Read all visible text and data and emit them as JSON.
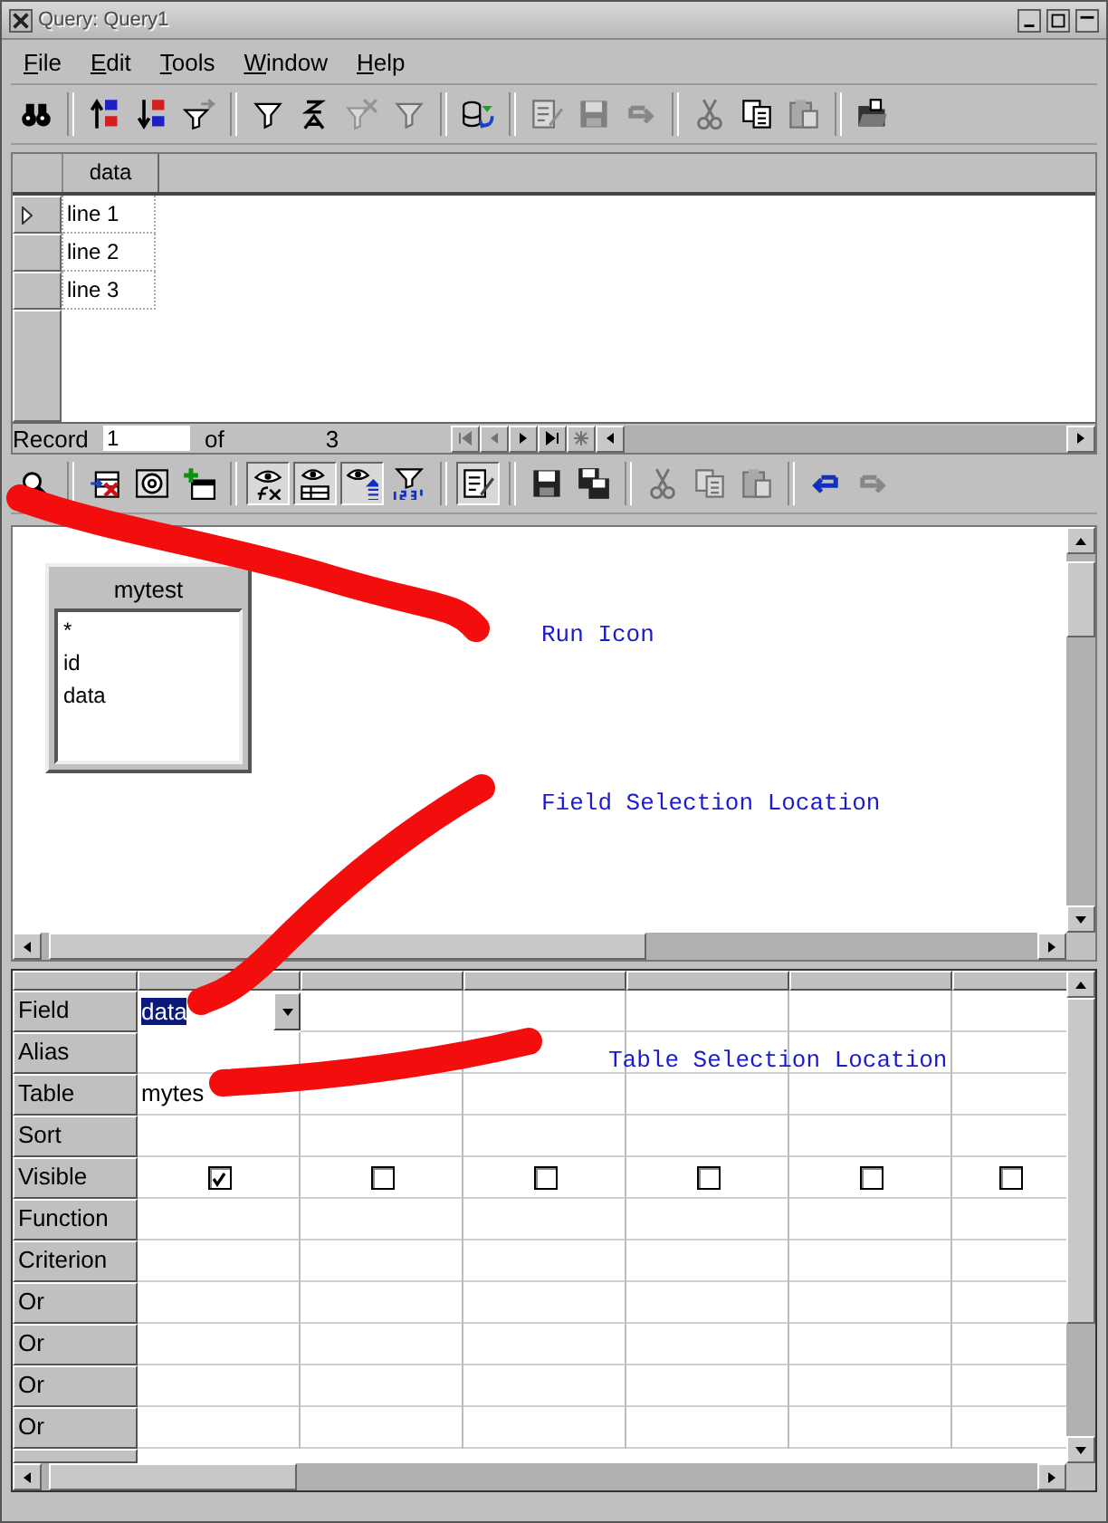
{
  "window": {
    "title": "Query: Query1"
  },
  "menu": [
    "File",
    "Edit",
    "Tools",
    "Window",
    "Help"
  ],
  "toolbar": [
    {
      "kind": "binoculars",
      "disabled": false,
      "pressed": false
    },
    {
      "kind": "separator"
    },
    {
      "kind": "sort_asc",
      "disabled": false,
      "pressed": false
    },
    {
      "kind": "sort_desc",
      "disabled": false,
      "pressed": false
    },
    {
      "kind": "filter_arrow",
      "disabled": false,
      "pressed": false
    },
    {
      "kind": "separator"
    },
    {
      "kind": "filter",
      "disabled": false,
      "pressed": false
    },
    {
      "kind": "sort_plain",
      "disabled": false,
      "pressed": false
    },
    {
      "kind": "filter_remove",
      "disabled": true,
      "pressed": false
    },
    {
      "kind": "filter",
      "disabled": true,
      "pressed": false
    },
    {
      "kind": "separator"
    },
    {
      "kind": "refresh_db",
      "disabled": false,
      "pressed": false
    },
    {
      "kind": "separator"
    },
    {
      "kind": "edit_doc",
      "disabled": true,
      "pressed": false
    },
    {
      "kind": "save",
      "disabled": true,
      "pressed": false
    },
    {
      "kind": "redo",
      "disabled": true,
      "pressed": false
    },
    {
      "kind": "separator"
    },
    {
      "kind": "cut",
      "disabled": true,
      "pressed": false
    },
    {
      "kind": "copy",
      "disabled": false,
      "pressed": false
    },
    {
      "kind": "paste",
      "disabled": true,
      "pressed": false
    },
    {
      "kind": "separator"
    },
    {
      "kind": "open_folder",
      "disabled": false,
      "pressed": false
    }
  ],
  "data_grid": {
    "columns": [
      "data"
    ],
    "rows": [
      {
        "cells": [
          "line 1"
        ],
        "current": true
      },
      {
        "cells": [
          "line 2"
        ],
        "current": false
      },
      {
        "cells": [
          "line 3"
        ],
        "current": false
      }
    ]
  },
  "record_bar": {
    "label": "Record",
    "value": "1",
    "of_label": "of",
    "total": "3",
    "nav": [
      {
        "kind": "first",
        "disabled": true
      },
      {
        "kind": "prev",
        "disabled": true
      },
      {
        "kind": "next",
        "disabled": false
      },
      {
        "kind": "last",
        "disabled": false
      },
      {
        "kind": "new",
        "disabled": true
      }
    ]
  },
  "design_toolbar": [
    {
      "kind": "run",
      "disabled": false,
      "pressed": false
    },
    {
      "kind": "separator"
    },
    {
      "kind": "delete_table",
      "disabled": false,
      "pressed": false
    },
    {
      "kind": "at_box",
      "disabled": false,
      "pressed": false
    },
    {
      "kind": "add_table",
      "disabled": false,
      "pressed": false
    },
    {
      "kind": "separator"
    },
    {
      "kind": "eye_fx",
      "disabled": false,
      "pressed": true
    },
    {
      "kind": "eye_table",
      "disabled": false,
      "pressed": true
    },
    {
      "kind": "eye_sort",
      "disabled": false,
      "pressed": true
    },
    {
      "kind": "filter_123",
      "disabled": false,
      "pressed": false
    },
    {
      "kind": "separator"
    },
    {
      "kind": "edit_doc",
      "disabled": false,
      "pressed": true
    },
    {
      "kind": "separator"
    },
    {
      "kind": "save",
      "disabled": false,
      "pressed": false
    },
    {
      "kind": "save_all",
      "disabled": false,
      "pressed": false
    },
    {
      "kind": "separator"
    },
    {
      "kind": "cut",
      "disabled": true,
      "pressed": false
    },
    {
      "kind": "copy",
      "disabled": true,
      "pressed": false
    },
    {
      "kind": "paste",
      "disabled": true,
      "pressed": false
    },
    {
      "kind": "separator"
    },
    {
      "kind": "undo",
      "disabled": false,
      "pressed": false
    },
    {
      "kind": "redo",
      "disabled": true,
      "pressed": false
    }
  ],
  "table_box": {
    "title": "mytest",
    "fields": [
      "*",
      "id",
      "data"
    ]
  },
  "annotations": [
    {
      "text": "Run Icon"
    },
    {
      "text": "Field Selection Location"
    },
    {
      "text": "Table  Selection Location"
    }
  ],
  "query_grid": {
    "row_labels": [
      "Field",
      "Alias",
      "Table",
      "Sort",
      "Visible",
      "Function",
      "Criterion",
      "Or",
      "Or",
      "Or",
      "Or"
    ],
    "columns": [
      {
        "field": "data",
        "field_text_selected": true,
        "table": "mytes",
        "visible": true
      },
      {
        "visible": false
      },
      {
        "visible": false
      },
      {
        "visible": false
      },
      {
        "visible": false
      },
      {
        "visible": false
      }
    ]
  }
}
